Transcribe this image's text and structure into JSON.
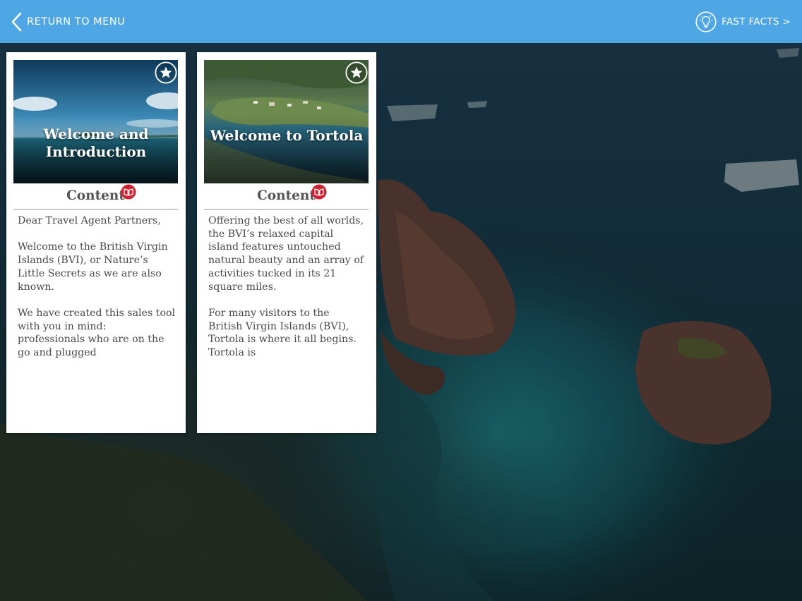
{
  "topbar": {
    "back_label": "RETURN TO MENU",
    "facts_label": "FAST FACTS >",
    "bar_color": "#4fa6e4"
  },
  "cards": [
    {
      "title": "Welcome and Introduction",
      "section_label": "Content",
      "paragraphs": [
        "Dear Travel Agent Partners,",
        "Welcome to the British Virgin Islands (BVI), or Nature’s Little Secrets as we are also known.",
        "We have created this sales tool with you in mind: professionals who are on the go and plugged"
      ]
    },
    {
      "title": "Welcome to Tortola",
      "section_label": "Content",
      "paragraphs": [
        "Offering the best of all worlds, the BVI’s relaxed capital island features untouched natural beauty and an array of activities tucked in its 21 square miles.",
        "For many visitors to the British Virgin Islands (BVI), Tortola is where it all begins. Tortola is"
      ]
    }
  ],
  "icons": {
    "back": "chevron-left-icon",
    "facts": "lightbulb-icon",
    "favorite": "star-icon",
    "content": "book-icon"
  },
  "colors": {
    "content_badge": "#d0202f",
    "body_text": "#4a4a4a"
  }
}
